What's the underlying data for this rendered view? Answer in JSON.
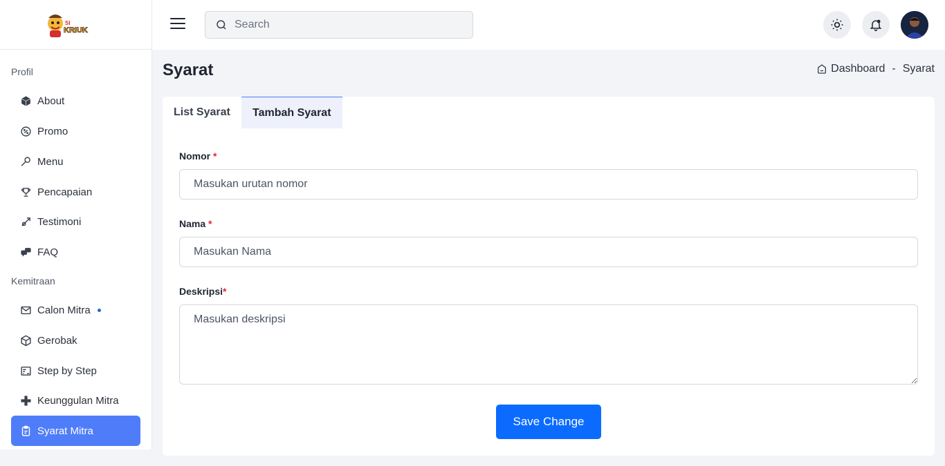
{
  "brand": {
    "logo_top": "SI",
    "logo_bottom": "KRIUK"
  },
  "sidebar": {
    "sections": [
      {
        "title": "Profil"
      },
      {
        "title": "Kemitraan"
      }
    ],
    "items": [
      {
        "label": "About",
        "icon": "box-icon"
      },
      {
        "label": "Promo",
        "icon": "discount-icon"
      },
      {
        "label": "Menu",
        "icon": "spoon-icon"
      },
      {
        "label": "Pencapaian",
        "icon": "trophy-icon"
      },
      {
        "label": "Testimoni",
        "icon": "megaphone-icon"
      },
      {
        "label": "FAQ",
        "icon": "chat-icon"
      },
      {
        "label": "Calon Mitra",
        "icon": "mail-icon",
        "badge_dot": true
      },
      {
        "label": "Gerobak",
        "icon": "package-icon"
      },
      {
        "label": "Step by Step",
        "icon": "steps-icon"
      },
      {
        "label": "Keunggulan Mitra",
        "icon": "plus-icon"
      },
      {
        "label": "Syarat Mitra",
        "icon": "clipboard-icon",
        "active": true
      }
    ]
  },
  "header": {
    "search_placeholder": "Search",
    "theme_icon": "sun-icon",
    "notification_icon": "bell-icon"
  },
  "page": {
    "title": "Syarat",
    "breadcrumb": [
      "Dashboard",
      "-",
      "Syarat"
    ]
  },
  "tabs": [
    {
      "label": "List Syarat",
      "active": false
    },
    {
      "label": "Tambah Syarat",
      "active": true
    }
  ],
  "form": {
    "nomor_label": "Nomor",
    "nomor_placeholder": "Masukan urutan nomor",
    "nama_label": "Nama",
    "nama_placeholder": "Masukan Nama",
    "deskripsi_label": "Deskripsi",
    "deskripsi_placeholder": "Masukan deskripsi",
    "required_mark": "*",
    "submit_label": "Save Change"
  },
  "colors": {
    "accent": "#4f7df9",
    "primary_button": "#0b6bff",
    "required": "#e0243a"
  }
}
